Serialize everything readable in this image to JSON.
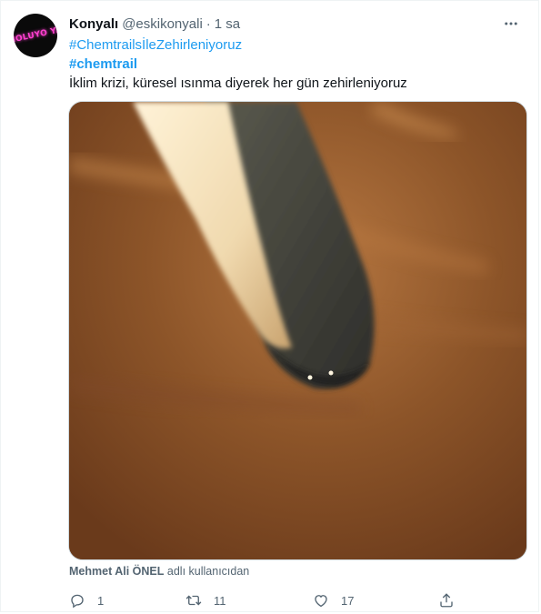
{
  "tweet": {
    "author_name": "Konyalı",
    "author_handle": "@eskikonyali",
    "separator": "·",
    "time": "1 sa",
    "avatar_logo_text": "NOLUYO YA",
    "hashtag_1": "#ChemtrailsİleZehirleniyoruz",
    "hashtag_2": "#chemtrail",
    "text": "İklim krizi, küresel ısınma diyerek her gün zehirleniyoruz",
    "media_credit_name": "Mehmet Ali ÖNEL",
    "media_credit_suffix": "adlı kullanıcıdan"
  },
  "actions": {
    "reply_count": "1",
    "retweet_count": "11",
    "like_count": "17",
    "share_count": ""
  },
  "icons": {
    "more": "more-icon",
    "reply": "reply-icon",
    "retweet": "retweet-icon",
    "like": "heart-icon",
    "share": "share-icon"
  },
  "colors": {
    "link": "#1d9bf0",
    "muted": "#536471",
    "text": "#0f1419",
    "sky": "#8a5128",
    "avatar_neon": "#ff3fd0"
  }
}
